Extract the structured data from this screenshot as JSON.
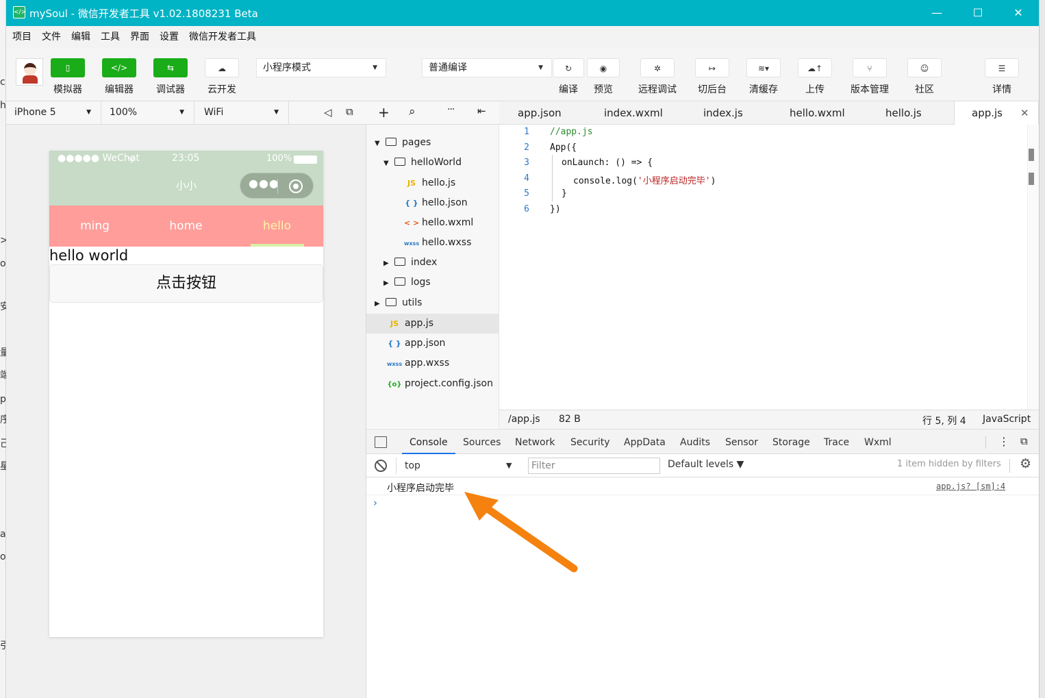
{
  "window": {
    "title": "mySoul - 微信开发者工具 v1.02.1808231 Beta",
    "app_icon": "</>",
    "minimize": "—",
    "maximize": "☐",
    "close": "✕"
  },
  "menu": [
    "项目",
    "文件",
    "编辑",
    "工具",
    "界面",
    "设置",
    "微信开发者工具"
  ],
  "toolbar": {
    "simulator": "模拟器",
    "editor": "编辑器",
    "debugger": "调试器",
    "cloud": "云开发",
    "mode_select": "小程序模式",
    "compile_select": "普通编译",
    "compile": "编译",
    "preview": "预览",
    "remote_debug": "远程调试",
    "background": "切后台",
    "clear_cache": "清缓存",
    "upload": "上传",
    "version": "版本管理",
    "community": "社区",
    "details": "详情"
  },
  "device_bar": {
    "device": "iPhone 5",
    "zoom": "100%",
    "network": "WiFi"
  },
  "simulator": {
    "status_left": "●●●●● WeChat",
    "status_time": "23:05",
    "status_battery": "100%",
    "nav_title": "小小",
    "tabs": [
      "ming",
      "home",
      "hello"
    ],
    "active_tab": "hello",
    "text": "hello world",
    "button": "点击按钮",
    "colors": {
      "nav_bg": "#c7dbc6",
      "tab_bg": "#ff9d9a",
      "active_tab": "#fff6a8"
    }
  },
  "file_tree": {
    "items": [
      {
        "label": "pages",
        "type": "folder",
        "open": true
      },
      {
        "label": "helloWorld",
        "type": "folder",
        "open": true
      },
      {
        "label": "hello.js",
        "type": "js",
        "icon": "JS"
      },
      {
        "label": "hello.json",
        "type": "json",
        "icon": "{ }"
      },
      {
        "label": "hello.wxml",
        "type": "wxml",
        "icon": "< >"
      },
      {
        "label": "hello.wxss",
        "type": "wxss",
        "icon": "wxss"
      },
      {
        "label": "index",
        "type": "folder",
        "open": false
      },
      {
        "label": "logs",
        "type": "folder",
        "open": false
      },
      {
        "label": "utils",
        "type": "folder",
        "open": false
      },
      {
        "label": "app.js",
        "type": "js",
        "icon": "JS",
        "selected": true
      },
      {
        "label": "app.json",
        "type": "json",
        "icon": "{ }"
      },
      {
        "label": "app.wxss",
        "type": "wxss",
        "icon": "wxss"
      },
      {
        "label": "project.config.json",
        "type": "config",
        "icon": "{o}"
      }
    ]
  },
  "editor_tabs": [
    "app.json",
    "index.wxml",
    "index.js",
    "hello.wxml",
    "hello.js",
    "app.js"
  ],
  "active_editor_tab": "app.js",
  "code": {
    "line_numbers": [
      "1",
      "2",
      "3",
      "4",
      "5",
      "6"
    ],
    "l1": "//app.js",
    "l2": "App({",
    "l3": "onLaunch: () => {",
    "l4_a": "console.log(",
    "l4_s": "'小程序启动完毕'",
    "l4_b": ")",
    "l5": "}",
    "l6": "})"
  },
  "status_bar": {
    "path": "/app.js",
    "size": "82 B",
    "position": "行 5, 列 4",
    "language": "JavaScript"
  },
  "devtools": {
    "tabs": [
      "Console",
      "Sources",
      "Network",
      "Security",
      "AppData",
      "Audits",
      "Sensor",
      "Storage",
      "Trace",
      "Wxml"
    ],
    "active_tab": "Console",
    "context": "top",
    "filter_placeholder": "Filter",
    "levels": "Default levels ▼",
    "hidden": "1 item hidden by filters",
    "log_message": "小程序启动完毕",
    "log_source": "app.js? [sm]:4",
    "prompt": "›"
  },
  "annotation_color": "#f5820f"
}
